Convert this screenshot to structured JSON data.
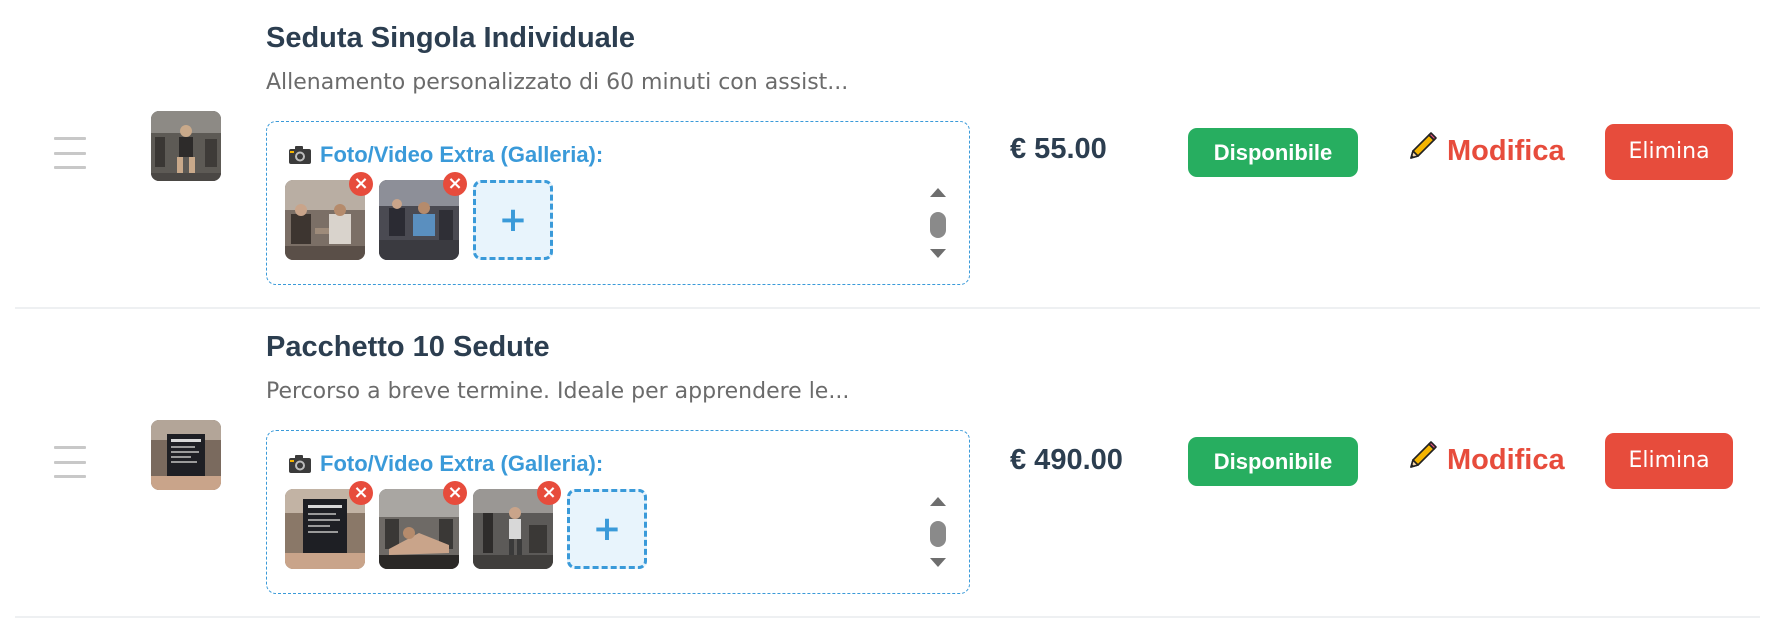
{
  "items": [
    {
      "title": "Seduta Singola Individuale",
      "description": "Allenamento personalizzato di 60 minuti con assist...",
      "gallery_label": "Foto/Video Extra (Galleria):",
      "media_count": 2,
      "add_label": "+",
      "remove_label": "×",
      "price": "€ 55.00",
      "status": "Disponibile",
      "edit_label": "Modifica",
      "delete_label": "Elimina"
    },
    {
      "title": "Pacchetto 10 Sedute",
      "description": "Percorso a breve termine. Ideale per apprendere le...",
      "gallery_label": "Foto/Video Extra (Galleria):",
      "media_count": 3,
      "add_label": "+",
      "remove_label": "×",
      "price": "€ 490.00",
      "status": "Disponibile",
      "edit_label": "Modifica",
      "delete_label": "Elimina"
    }
  ],
  "icons": {
    "drag": "drag-handle-icon",
    "camera": "camera-icon",
    "edit": "pencil-icon",
    "remove": "close-icon"
  },
  "colors": {
    "accent": "#3a9ad9",
    "success": "#27ae60",
    "danger": "#e74c3c",
    "heading": "#2c3e50",
    "muted": "#6b6b6b"
  }
}
